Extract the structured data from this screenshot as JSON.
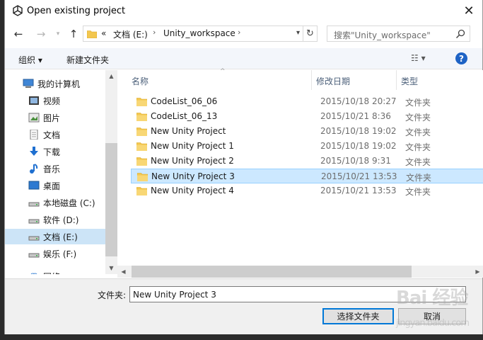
{
  "window": {
    "title": "Open existing project"
  },
  "address": {
    "overflow": "«",
    "crumbs": [
      "文档 (E:)",
      "Unity_workspace"
    ]
  },
  "search": {
    "placeholder": "搜索\"Unity_workspace\""
  },
  "toolbar": {
    "organize": "组织 ▾",
    "new_folder": "新建文件夹"
  },
  "nav": {
    "items": [
      {
        "label": "我的计算机",
        "icon": "computer-icon"
      },
      {
        "label": "视频",
        "icon": "video-icon"
      },
      {
        "label": "图片",
        "icon": "picture-icon"
      },
      {
        "label": "文档",
        "icon": "document-icon"
      },
      {
        "label": "下载",
        "icon": "download-icon"
      },
      {
        "label": "音乐",
        "icon": "music-icon"
      },
      {
        "label": "桌面",
        "icon": "desktop-icon"
      },
      {
        "label": "本地磁盘 (C:)",
        "icon": "drive-icon"
      },
      {
        "label": "软件 (D:)",
        "icon": "drive-icon"
      },
      {
        "label": "文档 (E:)",
        "icon": "drive-icon",
        "selected": true
      },
      {
        "label": "娱乐 (F:)",
        "icon": "drive-icon"
      },
      {
        "label": "网络",
        "icon": "network-icon"
      }
    ]
  },
  "columns": {
    "name": "名称",
    "modified": "修改日期",
    "type": "类型"
  },
  "files": [
    {
      "name": "CodeList_06_06",
      "modified": "2015/10/18 20:27",
      "type": "文件夹"
    },
    {
      "name": "CodeList_06_13",
      "modified": "2015/10/21 8:36",
      "type": "文件夹"
    },
    {
      "name": "New Unity Project",
      "modified": "2015/10/18 19:02",
      "type": "文件夹"
    },
    {
      "name": "New Unity Project 1",
      "modified": "2015/10/18 19:02",
      "type": "文件夹"
    },
    {
      "name": "New Unity Project 2",
      "modified": "2015/10/18 9:31",
      "type": "文件夹"
    },
    {
      "name": "New Unity Project 3",
      "modified": "2015/10/21 13:53",
      "type": "文件夹",
      "selected": true
    },
    {
      "name": "New Unity Project 4",
      "modified": "2015/10/21 13:53",
      "type": "文件夹"
    }
  ],
  "footer": {
    "folder_label": "文件夹:",
    "folder_value": "New Unity Project 3",
    "select_button": "选择文件夹",
    "cancel_button": "取消"
  },
  "watermark": {
    "main": "Bai 经验",
    "sub": "jingyan.baidu.com"
  },
  "colors": {
    "selection": "#cce8ff",
    "nav_selection": "#cce4f7",
    "folder": "#f3c74f",
    "accent": "#0078d7"
  }
}
